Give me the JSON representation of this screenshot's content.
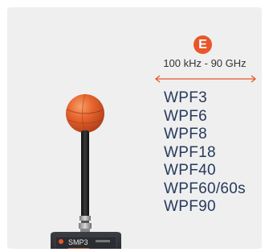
{
  "badge": {
    "letter": "E",
    "color": "#e8572a"
  },
  "frequency_range": "100 kHz - 90 GHz",
  "arrow": {
    "color": "#e8572a",
    "icon": "double-arrow-icon"
  },
  "models": [
    "WPF3",
    "WPF6",
    "WPF8",
    "WPF18",
    "WPF40",
    "WPF60/60s",
    "WPF90"
  ],
  "device_label": "SMP3",
  "colors": {
    "card_bg": "#efefef",
    "model_text": "#263a5c",
    "probe_sphere": "#e8572a"
  }
}
